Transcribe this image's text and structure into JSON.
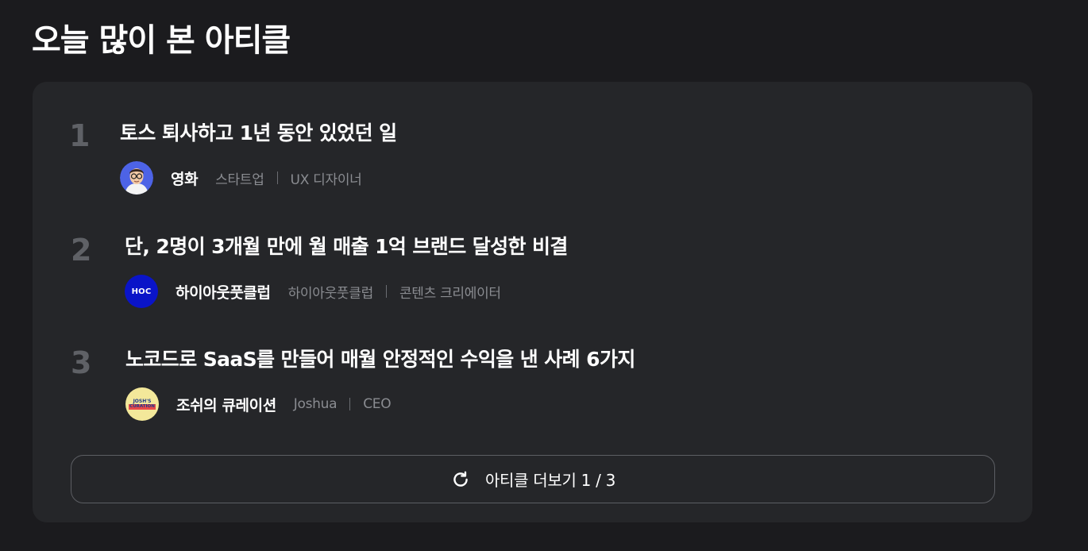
{
  "section": {
    "title": "오늘 많이 본 아티클"
  },
  "articles": [
    {
      "rank": "1",
      "title": "토스 퇴사하고 1년 동안 있었던 일",
      "author": "영화",
      "company": "스타트업",
      "role": "UX 디자이너",
      "avatar_icon": "memoji-glasses-avatar"
    },
    {
      "rank": "2",
      "title": "단, 2명이 3개월 만에 월 매출 1억 브랜드 달성한 비결",
      "author": "하이아웃풋클럽",
      "company": "하이아웃풋클럽",
      "role": "콘텐츠 크리에이터",
      "avatar_text": "HOC",
      "avatar_color": "#0a14c8"
    },
    {
      "rank": "3",
      "title": "노코드로 SaaS를 만들어 매월 안정적인 수익을 낸 사례 6가지",
      "author": "조쉬의 큐레이션",
      "company": "Joshua",
      "role": "CEO",
      "avatar_text_line1": "JOSH'S",
      "avatar_text_line2": "CURATION",
      "avatar_color": "#f3e89a"
    }
  ],
  "more_button": {
    "label": "아티클 더보기 1 / 3",
    "icon": "refresh-icon"
  },
  "colors": {
    "background": "#1b1b1e",
    "card": "#252629",
    "muted_text": "#8a8c91",
    "rank_text": "#5f6166"
  }
}
